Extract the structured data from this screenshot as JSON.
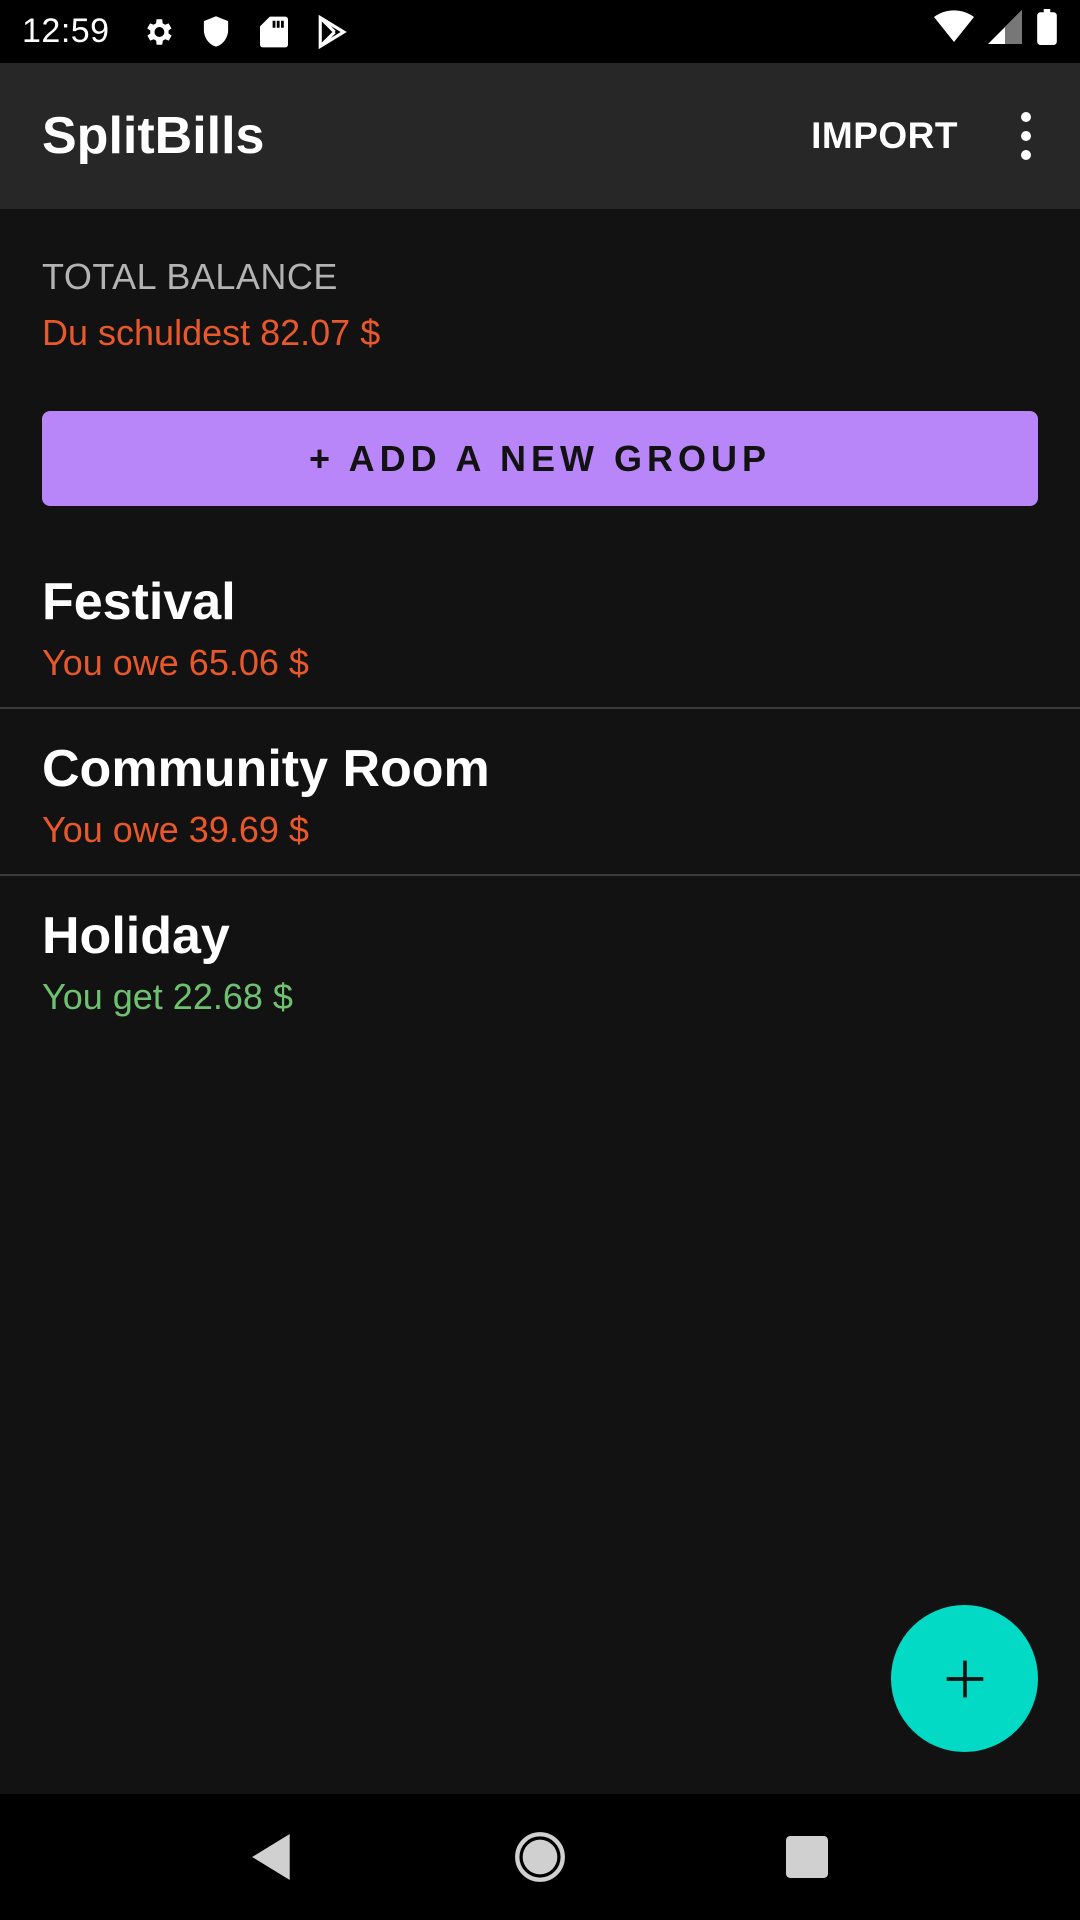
{
  "status_bar": {
    "time": "12:59",
    "icons": [
      "gear-icon",
      "shield-icon",
      "sd-card-icon",
      "play-store-icon",
      "wifi-icon",
      "signal-icon",
      "battery-icon"
    ]
  },
  "app_bar": {
    "title": "SplitBills",
    "import_label": "IMPORT",
    "overflow_icon": "more-vert-icon"
  },
  "balance": {
    "label": "TOTAL BALANCE",
    "value": "Du schuldest 82.07 $"
  },
  "add_group": {
    "label": "+ ADD A NEW GROUP"
  },
  "groups": [
    {
      "name": "Festival",
      "balance": "You owe 65.06 $",
      "status": "owe"
    },
    {
      "name": "Community Room",
      "balance": "You owe 39.69 $",
      "status": "owe"
    },
    {
      "name": "Holiday",
      "balance": "You get 22.68 $",
      "status": "get"
    }
  ],
  "fab": {
    "icon": "plus-icon"
  },
  "nav_bar": {
    "icons": [
      "back-icon",
      "home-icon",
      "recents-icon"
    ]
  },
  "colors": {
    "accent": "#b886f9",
    "fab": "#03dac5",
    "owe": "#e8582a",
    "get": "#6ec16f",
    "background": "#121212",
    "app_bar": "#272727"
  }
}
